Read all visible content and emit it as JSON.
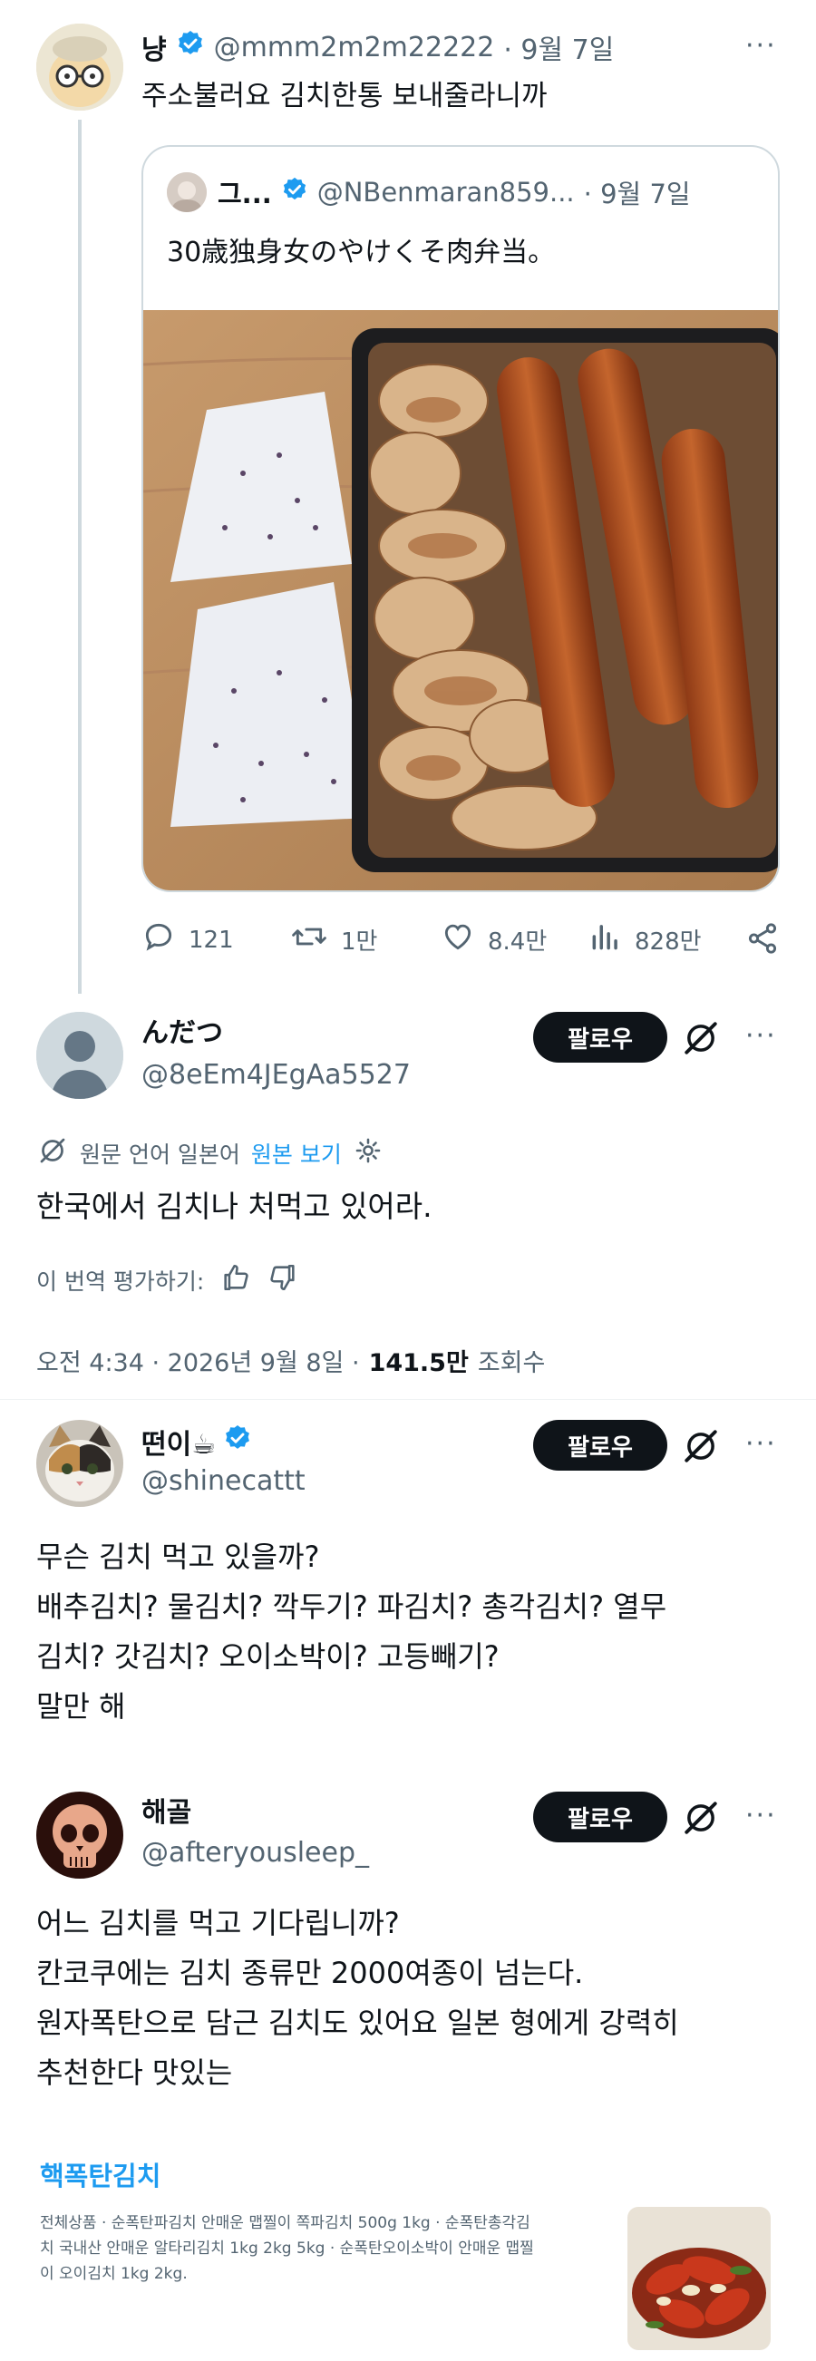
{
  "original_tweet": {
    "display_name": "냥",
    "handle": "@mmm2m2m22222",
    "date": "· 9월 7일",
    "text": "주소불러요 김치한통 보내줄라니까"
  },
  "quoted_tweet": {
    "display_name": "그...",
    "handle": "@NBenmaran859...",
    "date": "· 9월 7일",
    "text": "30歳独身女のやけくそ肉弁当。"
  },
  "stats": {
    "replies": "121",
    "retweets": "1만",
    "likes": "8.4만",
    "views": "828만"
  },
  "main_tweet": {
    "display_name": "んだつ",
    "handle": "@8eEm4JEgAa5527",
    "follow_label": "팔로우",
    "translation_note": "원문 언어 일본어",
    "view_original": "원본 보기",
    "text": "한국에서 김치나 처먹고 있어라.",
    "rate_translation": "이 번역 평가하기:",
    "timestamp": "오전 4:34 · 2026년 9월 8일 ·",
    "view_count": "141.5만",
    "view_label": "조회수"
  },
  "replies": [
    {
      "display_name": "떤이☕",
      "handle": "@shinecattt",
      "follow_label": "팔로우",
      "text": "무슨 김치 먹고 있을까?\n배추김치? 물김치? 깍두기? 파김치? 총각김치? 열무\n김치? 갓김치? 오이소박이? 고등빼기?\n말만 해"
    },
    {
      "display_name": "해골",
      "handle": "@afteryousleep_",
      "follow_label": "팔로우",
      "text": "어느 김치를 먹고 기다립니까?\n칸코쿠에는 김치 종류만 2000여종이 넘는다.\n원자폭탄으로 담근 김치도 있어요 일본 형에게 강력히\n추천한다 맛있는"
    }
  ],
  "link_card": {
    "title": "핵폭탄김치",
    "description": "전체상품 · 순폭탄파김치 안매운 맵찔이 쪽파김치 500g 1kg · 순폭탄총각김\n치 국내산 안매운 알타리김치 1kg 2kg 5kg · 순폭탄오이소박이 안매운 맵찔\n이 오이김치 1kg 2kg."
  },
  "colors": {
    "text": "#0f1419",
    "muted": "#536471",
    "accent": "#1d9bf0",
    "border": "#cfd9de"
  }
}
